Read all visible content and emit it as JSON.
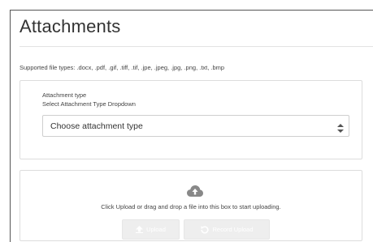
{
  "page": {
    "title": "Attachments",
    "supported_types": "Supported file types: .docx, .pdf, .gif, .tiff, .tif, .jpe, .jpeg, .jpg, .png, .txt, .bmp"
  },
  "attachment_type": {
    "label": "Attachment type",
    "sublabel": "Select Attachment Type Dropdown",
    "selected": "Choose attachment type"
  },
  "upload": {
    "message": "Click Upload or drag and drop a file into this box to start uploading.",
    "upload_button": "Upload",
    "record_button": "Record Upload"
  },
  "icons": {
    "select": "chevron-up-down-icon",
    "dropzone": "cloud-upload-icon",
    "upload": "arrow-up-icon",
    "record": "undo-icon"
  },
  "colors": {
    "button_bg": "#eeeeee",
    "button_text": "#ffffff",
    "border": "#dddddd",
    "text": "#333333"
  }
}
